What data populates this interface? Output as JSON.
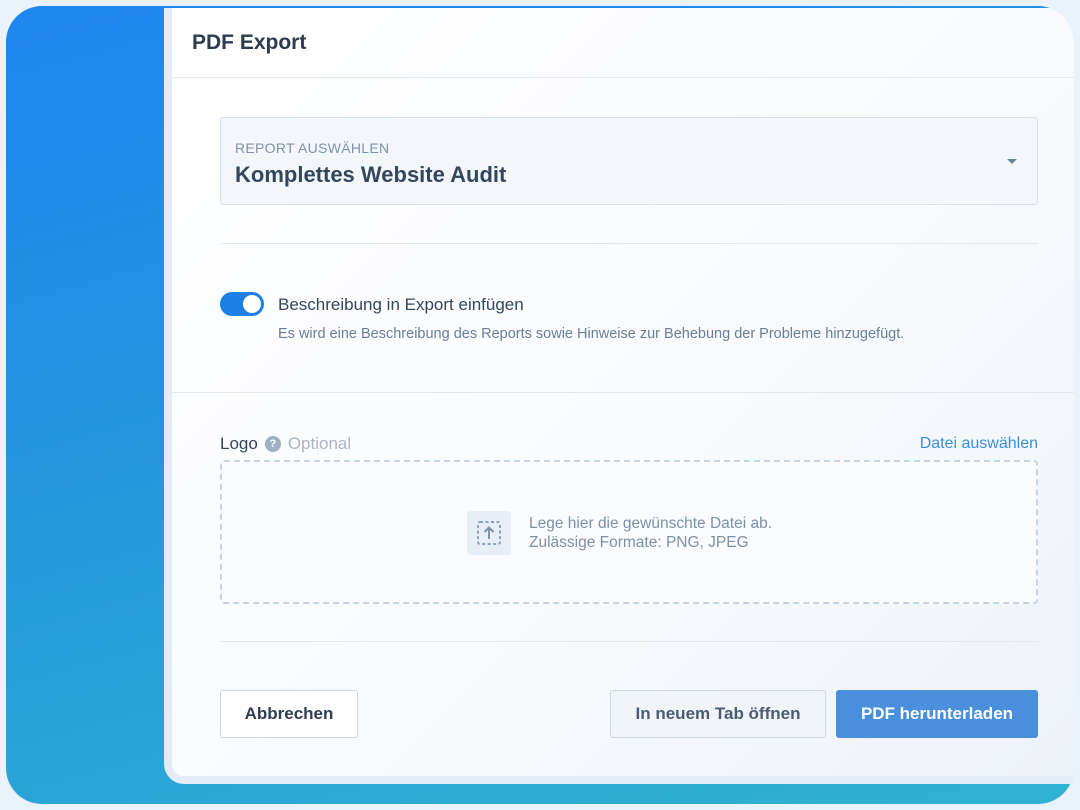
{
  "dialog": {
    "title": "PDF Export"
  },
  "report_select": {
    "label": "REPORT AUSWÄHLEN",
    "value": "Komplettes Website Audit"
  },
  "toggle": {
    "title": "Beschreibung in Export einfügen",
    "description": "Es wird eine Beschreibung des Reports sowie Hinweise zur Behebung der Probleme hinzugefügt.",
    "enabled": true
  },
  "logo": {
    "label": "Logo",
    "help": "?",
    "optional": "Optional",
    "file_link": "Datei auswählen",
    "drop_line1": "Lege hier die gewünschte Datei ab.",
    "drop_line2": "Zulässige Formate: PNG, JPEG"
  },
  "buttons": {
    "cancel": "Abbrechen",
    "open_tab": "In neuem Tab öffnen",
    "download": "PDF herunterladen"
  },
  "colors": {
    "accent": "#1d7fe6",
    "primary_button": "#4a8fdc",
    "link": "#3a8ee0"
  }
}
